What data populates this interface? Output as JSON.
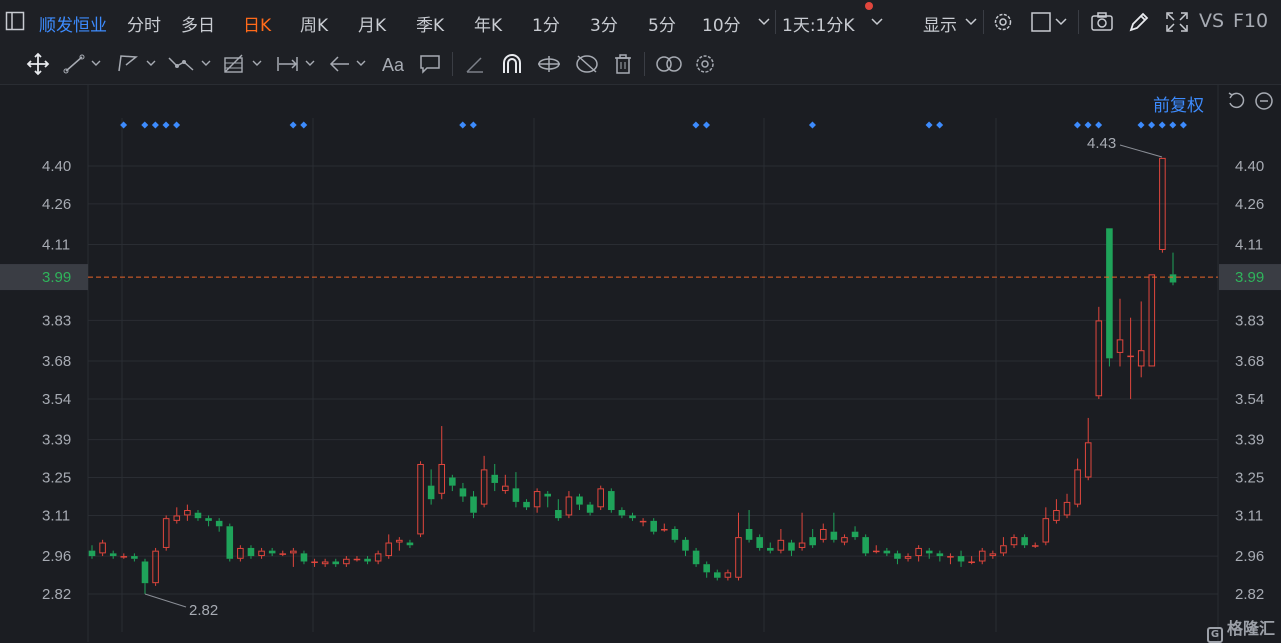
{
  "toolbar": {
    "stock_name": "顺发恒业",
    "tabs": [
      "分时",
      "多日",
      "日K",
      "周K",
      "月K",
      "季K",
      "年K",
      "1分",
      "3分",
      "5分",
      "10分"
    ],
    "active_tab": "日K",
    "period_select": "1天:1分K",
    "display_label": "显示",
    "vs_label": "VS",
    "f10_label": "F10"
  },
  "chart": {
    "fuquan_label": "前复权",
    "current_price": "3.99",
    "high_label": "4.43",
    "low_label": "2.82",
    "colors": {
      "up": "#e0463d",
      "down": "#1fa35a",
      "current_line": "#e8642a",
      "event_dot": "#3d8bfd"
    }
  },
  "chart_data": {
    "type": "candlestick",
    "y_ticks": [
      "4.40",
      "4.26",
      "4.11",
      "3.99",
      "3.83",
      "3.68",
      "3.54",
      "3.39",
      "3.25",
      "3.11",
      "2.96",
      "2.82"
    ],
    "ylim": [
      2.82,
      4.43
    ],
    "candles": [
      [
        2.98,
        2.96,
        3.0,
        2.95
      ],
      [
        2.97,
        3.01,
        3.02,
        2.96
      ],
      [
        2.97,
        2.96,
        2.98,
        2.95
      ],
      [
        2.96,
        2.96,
        2.97,
        2.95
      ],
      [
        2.96,
        2.95,
        2.97,
        2.94
      ],
      [
        2.94,
        2.86,
        2.95,
        2.82
      ],
      [
        2.86,
        2.98,
        2.99,
        2.85
      ],
      [
        2.99,
        3.1,
        3.11,
        2.98
      ],
      [
        3.09,
        3.11,
        3.14,
        3.08
      ],
      [
        3.11,
        3.13,
        3.15,
        3.09
      ],
      [
        3.12,
        3.1,
        3.13,
        3.09
      ],
      [
        3.1,
        3.09,
        3.11,
        3.07
      ],
      [
        3.09,
        3.07,
        3.1,
        3.05
      ],
      [
        3.07,
        2.95,
        3.08,
        2.94
      ],
      [
        2.95,
        2.99,
        3.0,
        2.94
      ],
      [
        2.99,
        2.96,
        3.0,
        2.95
      ],
      [
        2.96,
        2.98,
        2.99,
        2.95
      ],
      [
        2.98,
        2.97,
        2.99,
        2.96
      ],
      [
        2.97,
        2.97,
        2.98,
        2.96
      ],
      [
        2.97,
        2.98,
        2.99,
        2.92
      ],
      [
        2.97,
        2.94,
        2.98,
        2.93
      ],
      [
        2.94,
        2.94,
        2.95,
        2.92
      ],
      [
        2.93,
        2.94,
        2.95,
        2.92
      ],
      [
        2.94,
        2.93,
        2.95,
        2.92
      ],
      [
        2.93,
        2.95,
        2.96,
        2.92
      ],
      [
        2.95,
        2.95,
        2.96,
        2.94
      ],
      [
        2.95,
        2.94,
        2.96,
        2.93
      ],
      [
        2.94,
        2.97,
        2.98,
        2.93
      ],
      [
        2.96,
        3.01,
        3.04,
        2.95
      ],
      [
        3.01,
        3.02,
        3.03,
        2.98
      ],
      [
        3.01,
        3.0,
        3.02,
        2.99
      ],
      [
        3.04,
        3.3,
        3.31,
        3.03
      ],
      [
        3.22,
        3.17,
        3.28,
        3.15
      ],
      [
        3.19,
        3.3,
        3.44,
        3.17
      ],
      [
        3.25,
        3.22,
        3.26,
        3.2
      ],
      [
        3.21,
        3.18,
        3.23,
        3.16
      ],
      [
        3.18,
        3.12,
        3.2,
        3.1
      ],
      [
        3.15,
        3.28,
        3.33,
        3.14
      ],
      [
        3.26,
        3.23,
        3.3,
        3.2
      ],
      [
        3.2,
        3.22,
        3.26,
        3.19
      ],
      [
        3.21,
        3.16,
        3.27,
        3.14
      ],
      [
        3.16,
        3.14,
        3.17,
        3.13
      ],
      [
        3.14,
        3.2,
        3.21,
        3.12
      ],
      [
        3.19,
        3.18,
        3.2,
        3.14
      ],
      [
        3.13,
        3.1,
        3.17,
        3.09
      ],
      [
        3.11,
        3.18,
        3.2,
        3.1
      ],
      [
        3.18,
        3.15,
        3.19,
        3.13
      ],
      [
        3.15,
        3.12,
        3.16,
        3.11
      ],
      [
        3.14,
        3.21,
        3.22,
        3.13
      ],
      [
        3.2,
        3.13,
        3.21,
        3.12
      ],
      [
        3.13,
        3.11,
        3.14,
        3.1
      ],
      [
        3.11,
        3.1,
        3.12,
        3.09
      ],
      [
        3.09,
        3.09,
        3.1,
        3.07
      ],
      [
        3.09,
        3.05,
        3.1,
        3.04
      ],
      [
        3.06,
        3.06,
        3.08,
        3.05
      ],
      [
        3.06,
        3.02,
        3.07,
        3.01
      ],
      [
        3.02,
        2.98,
        3.03,
        2.96
      ],
      [
        2.98,
        2.93,
        2.99,
        2.92
      ],
      [
        2.93,
        2.9,
        2.94,
        2.88
      ],
      [
        2.9,
        2.88,
        2.91,
        2.87
      ],
      [
        2.88,
        2.9,
        2.91,
        2.87
      ],
      [
        2.88,
        3.03,
        3.12,
        2.87
      ],
      [
        3.06,
        3.02,
        3.13,
        3.01
      ],
      [
        3.03,
        2.99,
        3.04,
        2.98
      ],
      [
        2.99,
        2.98,
        3.01,
        2.97
      ],
      [
        2.98,
        3.02,
        3.06,
        2.97
      ],
      [
        3.01,
        2.98,
        3.02,
        2.96
      ],
      [
        2.99,
        3.01,
        3.12,
        2.98
      ],
      [
        3.03,
        3.0,
        3.06,
        2.99
      ],
      [
        3.02,
        3.06,
        3.08,
        3.01
      ],
      [
        3.05,
        3.02,
        3.12,
        3.01
      ],
      [
        3.01,
        3.03,
        3.04,
        3.0
      ],
      [
        3.05,
        3.03,
        3.07,
        3.02
      ],
      [
        3.03,
        2.97,
        3.04,
        2.96
      ],
      [
        2.98,
        2.98,
        3.0,
        2.97
      ],
      [
        2.98,
        2.97,
        2.99,
        2.96
      ],
      [
        2.97,
        2.95,
        2.98,
        2.93
      ],
      [
        2.95,
        2.96,
        2.97,
        2.94
      ],
      [
        2.96,
        2.99,
        3.0,
        2.94
      ],
      [
        2.98,
        2.97,
        2.99,
        2.95
      ],
      [
        2.97,
        2.96,
        2.98,
        2.94
      ],
      [
        2.96,
        2.96,
        2.97,
        2.93
      ],
      [
        2.96,
        2.94,
        2.98,
        2.92
      ],
      [
        2.94,
        2.94,
        2.96,
        2.93
      ],
      [
        2.94,
        2.98,
        2.99,
        2.93
      ],
      [
        2.96,
        2.97,
        2.98,
        2.95
      ],
      [
        2.97,
        3.0,
        3.03,
        2.96
      ],
      [
        3.0,
        3.03,
        3.04,
        2.99
      ],
      [
        3.03,
        3.0,
        3.04,
        2.99
      ],
      [
        3.0,
        3.0,
        3.01,
        2.99
      ],
      [
        3.01,
        3.1,
        3.14,
        3.0
      ],
      [
        3.09,
        3.13,
        3.17,
        3.08
      ],
      [
        3.11,
        3.16,
        3.19,
        3.1
      ],
      [
        3.15,
        3.28,
        3.32,
        3.14
      ],
      [
        3.25,
        3.38,
        3.47,
        3.24
      ],
      [
        3.55,
        3.83,
        3.88,
        3.54
      ],
      [
        4.17,
        3.69,
        4.17,
        3.66
      ],
      [
        3.71,
        3.76,
        3.91,
        3.66
      ],
      [
        3.7,
        3.7,
        3.84,
        3.54
      ],
      [
        3.66,
        3.72,
        3.9,
        3.62
      ],
      [
        3.66,
        4.0,
        4.0,
        3.66
      ],
      [
        4.09,
        4.43,
        4.43,
        4.08
      ],
      [
        4.0,
        3.97,
        4.08,
        3.96
      ]
    ],
    "event_markers": [
      [
        1
      ],
      [
        3,
        4,
        5,
        6
      ],
      [
        17,
        18
      ],
      [
        33,
        34
      ],
      [
        55,
        56
      ],
      [
        66
      ],
      [
        77,
        78
      ],
      [
        91,
        92,
        93
      ],
      [
        97,
        98,
        99,
        100,
        101
      ]
    ]
  }
}
